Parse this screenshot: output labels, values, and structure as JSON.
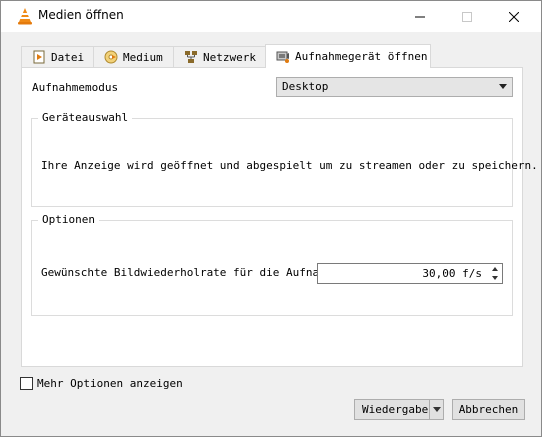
{
  "window": {
    "title": "Medien öffnen",
    "icon": "vlc-cone-icon"
  },
  "tabs": [
    {
      "label": "Datei",
      "icon": "file-play-icon",
      "active": false
    },
    {
      "label": "Medium",
      "icon": "disc-icon",
      "active": false
    },
    {
      "label": "Netzwerk",
      "icon": "network-icon",
      "active": false
    },
    {
      "label": "Aufnahmegerät öffnen",
      "icon": "capture-device-icon",
      "active": true
    }
  ],
  "capture": {
    "mode_label": "Aufnahmemodus",
    "mode_value": "Desktop",
    "device_group_title": "Geräteauswahl",
    "device_info": "Ihre Anzeige wird geöffnet und abgespielt um zu streamen oder zu speichern.",
    "options_group_title": "Optionen",
    "rate_label": "Gewünschte Bildwiederholrate für die Aufnahme",
    "rate_value": "30,00 f/s"
  },
  "footer": {
    "more_options_label": "Mehr Optionen anzeigen",
    "more_options_checked": false,
    "play_button": "Wiedergabe",
    "cancel_button": "Abbrechen"
  }
}
